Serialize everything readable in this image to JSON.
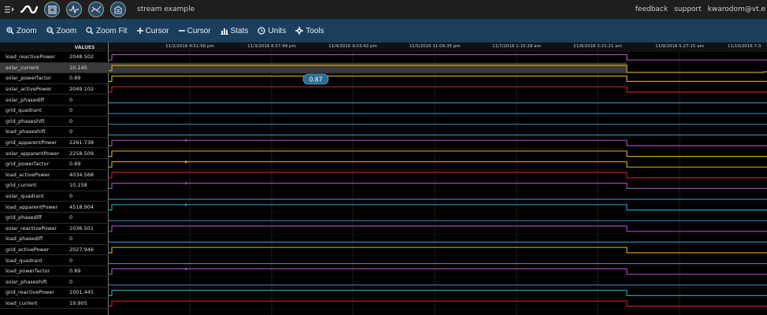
{
  "topbar": {
    "stream_title": "stream example",
    "links": {
      "feedback": "feedback",
      "support": "support",
      "user": "kwarodom@vt.e"
    }
  },
  "toolbar": {
    "items": [
      {
        "label": "Zoom",
        "icon": "zoom-in-icon"
      },
      {
        "label": "Zoom",
        "icon": "zoom-out-icon"
      },
      {
        "label": "Zoom Fit",
        "icon": "zoom-fit-icon"
      },
      {
        "label": "Cursor",
        "icon": "plus-icon"
      },
      {
        "label": "Cursor",
        "icon": "minus-icon"
      },
      {
        "label": "Stats",
        "icon": "bar-chart-icon"
      },
      {
        "label": "Units",
        "icon": "clock-icon"
      },
      {
        "label": "Tools",
        "icon": "gear-icon"
      }
    ]
  },
  "values_header": "VALUES",
  "time_ticks": [
    "11/2/2016 4:51:56 pm",
    "11/3/2016 6:57:49 pm",
    "11/4/2016 9:03:42 pm",
    "11/5/2016 11:09:35 pm",
    "11/7/2016 1:15:28 am",
    "11/8/2016 3:21:21 am",
    "11/9/2016 5:27:15 am",
    "11/10/2016 7:3"
  ],
  "cursor_badge": "0.87",
  "rows": [
    {
      "name": "load_reactivePower",
      "value": "2048.502",
      "color": "#a04ab0"
    },
    {
      "name": "solar_current",
      "value": "10.145",
      "color": "#c8a020"
    },
    {
      "name": "solar_powerfactor",
      "value": "0.89",
      "color": "#c8a020"
    },
    {
      "name": "solar_activePower",
      "value": "2049.102",
      "color": "#c02030"
    },
    {
      "name": "solar_phasediff",
      "value": "0",
      "color": "#3a7fa8"
    },
    {
      "name": "grid_quadrant",
      "value": "0",
      "color": "#3a7fa8"
    },
    {
      "name": "grid_phaseshift",
      "value": "0",
      "color": "#3a7fa8"
    },
    {
      "name": "load_phaseshift",
      "value": "0",
      "color": "#3a7fa8"
    },
    {
      "name": "grid_apparentPower",
      "value": "2261.738",
      "color": "#a04ab0"
    },
    {
      "name": "solar_apparentPower",
      "value": "2258.509",
      "color": "#c8a020"
    },
    {
      "name": "grid_powerfactor",
      "value": "0.89",
      "color": "#c8a020"
    },
    {
      "name": "load_activePower",
      "value": "4034.568",
      "color": "#c02030"
    },
    {
      "name": "grid_current",
      "value": "10.158",
      "color": "#a04ab0"
    },
    {
      "name": "solar_quadrant",
      "value": "0",
      "color": "#3a7fa8"
    },
    {
      "name": "load_apparentPower",
      "value": "4518.904",
      "color": "#20a0b0"
    },
    {
      "name": "grid_phasediff",
      "value": "0",
      "color": "#3a7fa8"
    },
    {
      "name": "solar_reactivePower",
      "value": "1036.501",
      "color": "#a04ab0"
    },
    {
      "name": "load_phasediff",
      "value": "0",
      "color": "#3a7fa8"
    },
    {
      "name": "grid_activePower",
      "value": "2027.946",
      "color": "#c8a020"
    },
    {
      "name": "load_quadrant",
      "value": "0",
      "color": "#3a7fa8"
    },
    {
      "name": "load_powerfactor",
      "value": "0.89",
      "color": "#a04ab0"
    },
    {
      "name": "solar_phaseshift",
      "value": "0",
      "color": "#3a7fa8"
    },
    {
      "name": "grid_reactivePower",
      "value": "1001.445",
      "color": "#20a0b0"
    },
    {
      "name": "load_current",
      "value": "19.905",
      "color": "#c02030"
    }
  ],
  "colors": {
    "toolbar_bg": "#1c3e5d",
    "topbar_bg": "#1e1e1e",
    "badge_bg": "#2a6d96"
  }
}
